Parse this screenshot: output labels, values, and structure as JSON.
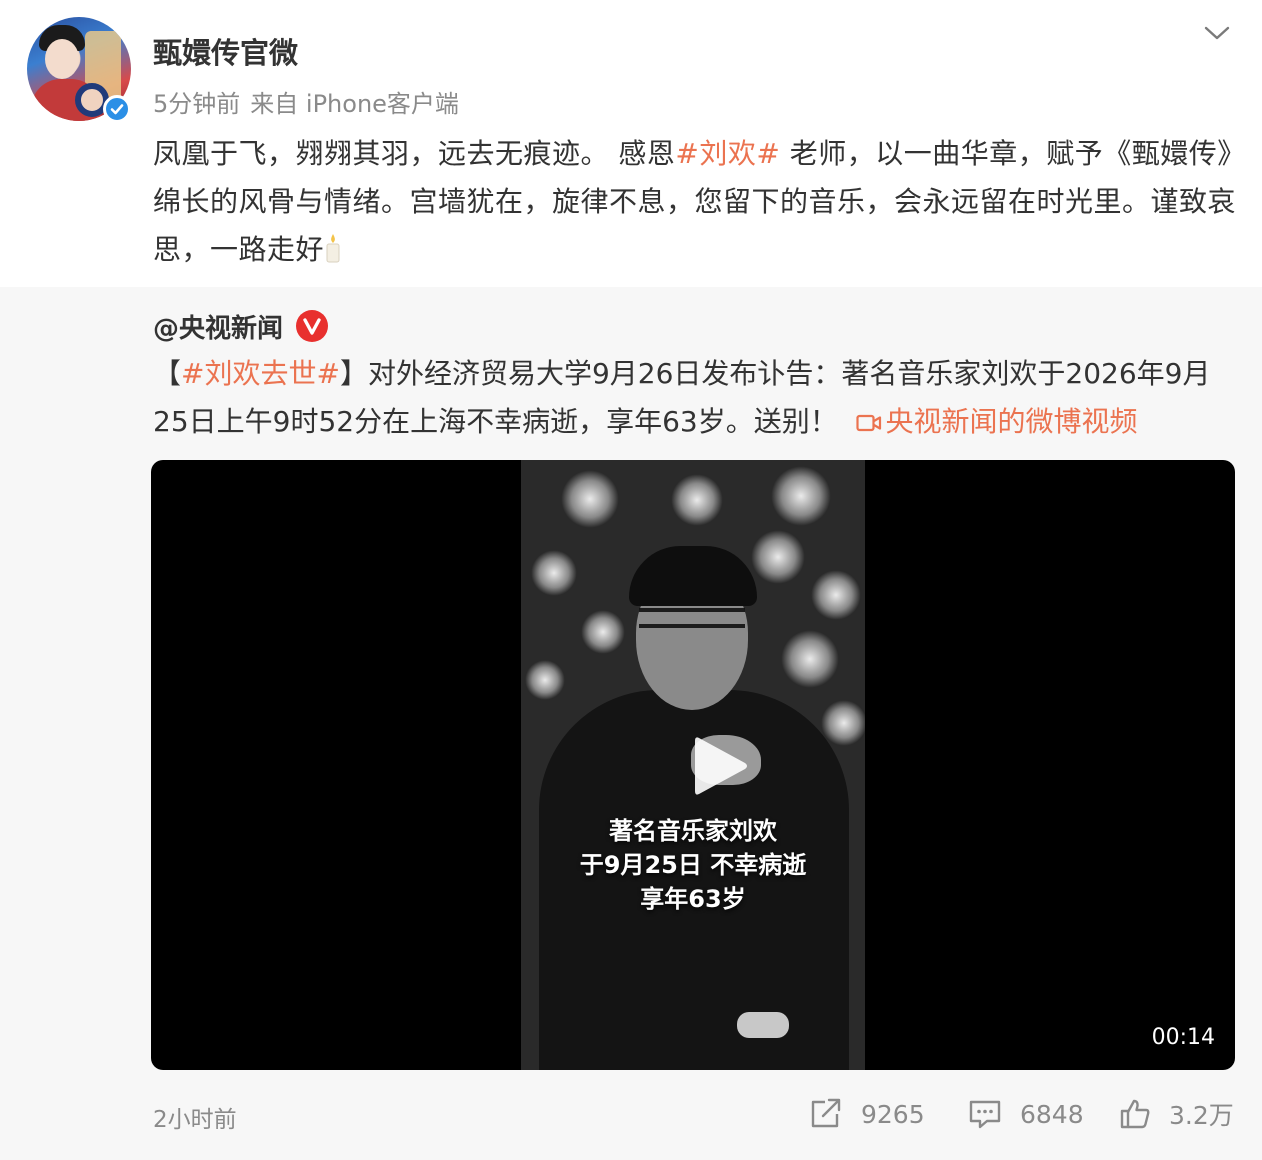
{
  "post": {
    "author": "甄嬛传官微",
    "time": "5分钟前",
    "source": "来自 iPhone客户端",
    "text_before": "凤凰于飞，翙翙其羽，远去无痕迹。 感恩",
    "topic": "#刘欢#",
    "text_after": " 老师，以一曲华章，赋予《甄嬛传》绵长的风骨与情绪。宫墙犹在，旋律不息，您留下的音乐，会永远留在时光里。谨致哀思，一路走好",
    "emoji": "candle-emoji"
  },
  "repost": {
    "user": "@央视新闻",
    "bracket_open": "【",
    "topic": "#刘欢去世#",
    "bracket_close": "】",
    "text": "对外经济贸易大学9月26日发布讣告：著名音乐家刘欢于2026年9月25日上午9时52分在上海不幸病逝，享年63岁。送别！",
    "video_link": "央视新闻的微博视频",
    "video": {
      "overlay_line1": "著名音乐家刘欢",
      "overlay_line2": "于9月25日 不幸病逝",
      "overlay_line3": "享年63岁",
      "duration": "00:14"
    },
    "time": "2小时前",
    "reposts": "9265",
    "comments": "6848",
    "likes": "3.2万"
  },
  "colors": {
    "accent": "#eb7350",
    "verified_blue": "#2b8fe6",
    "verified_red": "#e8302e",
    "text": "#333333",
    "muted": "#8a8a8a",
    "repost_bg": "#f7f7f7"
  }
}
